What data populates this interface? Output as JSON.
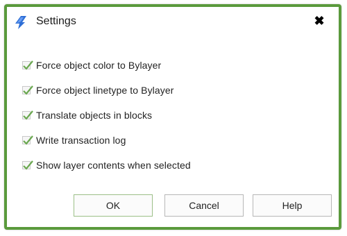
{
  "window": {
    "title": "Settings",
    "close_symbol": "✖",
    "app_icon": "app-logo-icon",
    "accent_color": "#5a9a3c"
  },
  "options": [
    {
      "label": "Force object color to Bylayer",
      "checked": true
    },
    {
      "label": "Force object linetype to Bylayer",
      "checked": true
    },
    {
      "label": "Translate objects in blocks",
      "checked": true
    },
    {
      "label": "Write transaction log",
      "checked": true
    },
    {
      "label": "Show layer contents when selected",
      "checked": true
    }
  ],
  "buttons": {
    "ok": "OK",
    "cancel": "Cancel",
    "help": "Help"
  }
}
